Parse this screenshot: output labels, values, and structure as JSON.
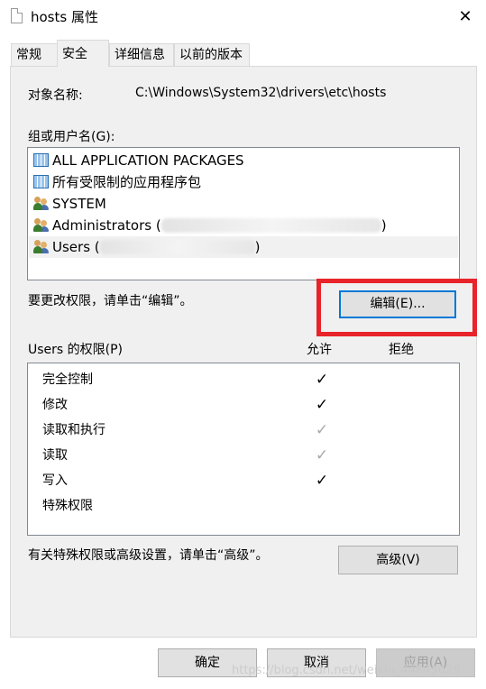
{
  "window": {
    "title": "hosts 属性",
    "close_symbol": "✕"
  },
  "tabs": [
    {
      "label": "常规"
    },
    {
      "label": "安全"
    },
    {
      "label": "详细信息"
    },
    {
      "label": "以前的版本"
    }
  ],
  "security": {
    "object_label": "对象名称:",
    "object_value": "C:\\Windows\\System32\\drivers\\etc\\hosts",
    "group_label": "组或用户名(G):",
    "groups": [
      {
        "label": "ALL APPLICATION PACKAGES",
        "icon": "package-icon"
      },
      {
        "label": "所有受限制的应用程序包",
        "icon": "package-icon"
      },
      {
        "label": "SYSTEM",
        "icon": "users-icon"
      },
      {
        "label": "Administrators (",
        "suffix": ")",
        "icon": "users-icon"
      },
      {
        "label": "Users (",
        "suffix": ")",
        "icon": "users-icon"
      }
    ],
    "change_hint": "要更改权限，请单击“编辑”。",
    "edit_button": "编辑(E)...",
    "perm_label": "Users 的权限(P)",
    "allow_header": "允许",
    "deny_header": "拒绝",
    "permissions": [
      {
        "name": "完全控制",
        "allow": "✓",
        "state": "checked"
      },
      {
        "name": "修改",
        "allow": "✓",
        "state": "checked"
      },
      {
        "name": "读取和执行",
        "allow": "✓",
        "state": "inherited"
      },
      {
        "name": "读取",
        "allow": "✓",
        "state": "inherited"
      },
      {
        "name": "写入",
        "allow": "✓",
        "state": "checked"
      },
      {
        "name": "特殊权限",
        "allow": "",
        "state": "none"
      }
    ],
    "advanced_hint": "有关特殊权限或高级设置，请单击“高级”。",
    "advanced_button": "高级(V)"
  },
  "footer": {
    "ok": "确定",
    "cancel": "取消",
    "apply": "应用(A)",
    "watermark": "https://blog.csdn.net/weixin_44843629"
  },
  "colors": {
    "highlight": "#e8232a",
    "focus": "#0078d7",
    "panel": "#f0f0f0"
  }
}
